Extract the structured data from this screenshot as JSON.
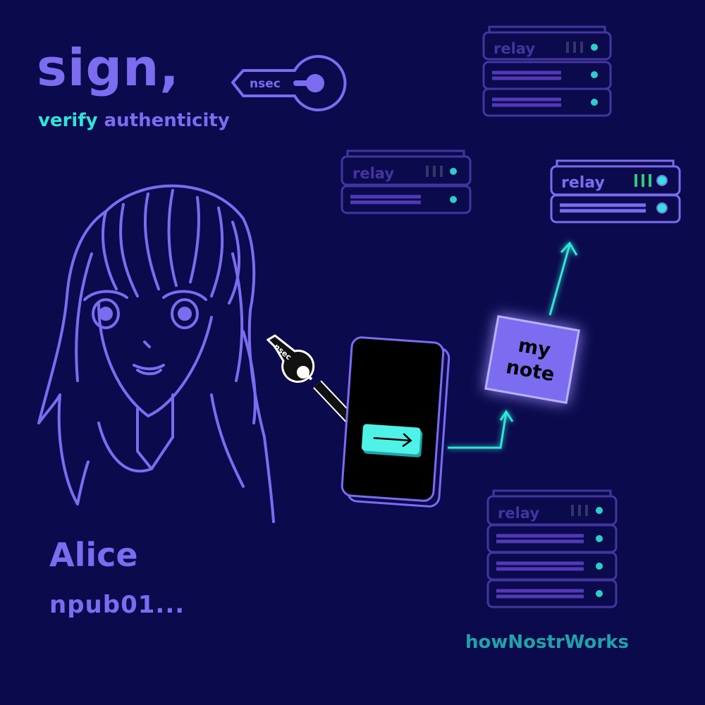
{
  "header": {
    "title": "sign,",
    "subtitle_accent": "verify",
    "subtitle_rest": " authenticity"
  },
  "key": {
    "label": "nsec"
  },
  "small_key": {
    "label": "nsec"
  },
  "user": {
    "name": "Alice",
    "npub": "npub01..."
  },
  "note": {
    "line1": "my",
    "line2": "note"
  },
  "relays": {
    "label": "relay",
    "items": [
      {
        "id": "top",
        "status": "inactive"
      },
      {
        "id": "middle",
        "status": "inactive"
      },
      {
        "id": "active",
        "status": "active"
      },
      {
        "id": "bottom",
        "status": "inactive"
      }
    ]
  },
  "brand": {
    "name": "howNostrWorks"
  },
  "colors": {
    "background": "#0b0a4d",
    "primary": "#7b6cf0",
    "accent": "#2ee6d6",
    "dim": "#4a3aa8",
    "active_led": "#2ecc71"
  }
}
